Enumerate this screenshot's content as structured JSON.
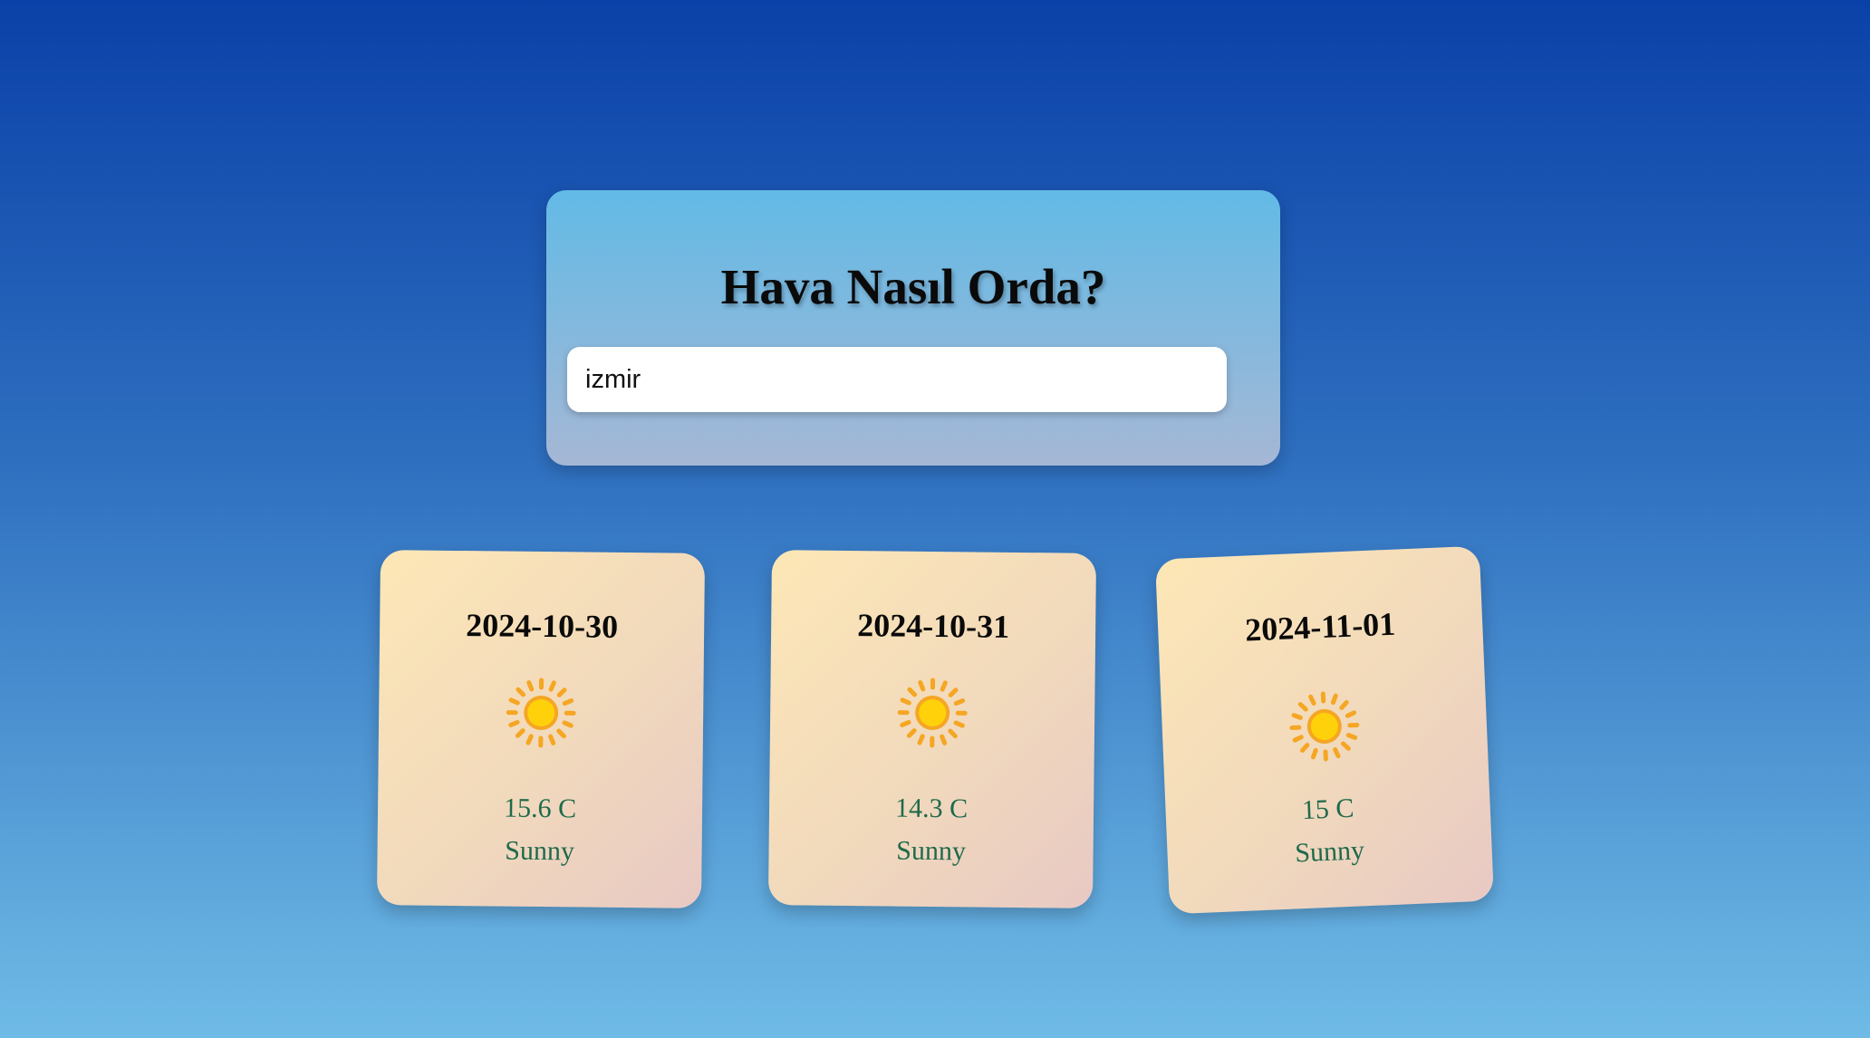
{
  "app": {
    "title": "Hava Nasıl Orda?"
  },
  "search": {
    "value": "izmir",
    "placeholder": ""
  },
  "colors": {
    "background_top": "#0a41a8",
    "background_bottom": "#6fbbe6",
    "panel_top": "#62bae6",
    "panel_bottom": "#a5b7d5",
    "card_gradient_start": "#fde7b6",
    "card_gradient_end": "#e8c9c4",
    "card_text": "#1f6a4b",
    "sun_core": "#ffd10a",
    "sun_rays": "#f5a623"
  },
  "forecast": [
    {
      "date": "2024-10-30",
      "icon": "sun-icon",
      "temperature": "15.6 C",
      "condition": "Sunny"
    },
    {
      "date": "2024-10-31",
      "icon": "sun-icon",
      "temperature": "14.3 C",
      "condition": "Sunny"
    },
    {
      "date": "2024-11-01",
      "icon": "sun-icon",
      "temperature": "15 C",
      "condition": "Sunny"
    }
  ]
}
